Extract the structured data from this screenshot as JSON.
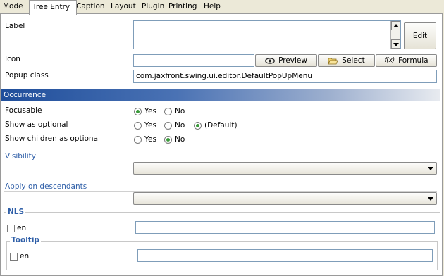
{
  "tabs": [
    "Mode",
    "Tree Entry",
    "Caption",
    "Layout",
    "PlugIn",
    "Printing",
    "Help"
  ],
  "active_tab": "Tree Entry",
  "form": {
    "label_label": "Label",
    "label_value": "",
    "edit_button": "Edit",
    "icon_label": "Icon",
    "icon_value": "",
    "preview_button": "Preview",
    "select_button": "Select",
    "formula_prefix": "f(x)",
    "formula_button": "Formula",
    "popup_label": "Popup class",
    "popup_value": "com.jaxfront.swing.ui.editor.DefaultPopUpMenu"
  },
  "occurrence": {
    "header": "Occurrence",
    "focusable": {
      "label": "Focusable",
      "yes": "Yes",
      "no": "No",
      "selected": "Yes"
    },
    "show_optional": {
      "label": "Show as optional",
      "yes": "Yes",
      "no": "No",
      "default": "(Default)",
      "selected": "(Default)"
    },
    "show_children": {
      "label": "Show children as optional",
      "yes": "Yes",
      "no": "No",
      "selected": "No"
    }
  },
  "visibility": {
    "label": "Visibility",
    "value": ""
  },
  "descendants": {
    "label": "Apply on descendants",
    "value": ""
  },
  "nls": {
    "title": "NLS",
    "lang": "en",
    "value": "",
    "tooltip": {
      "title": "Tooltip",
      "lang": "en",
      "value": ""
    }
  },
  "colors": {
    "section_header": "#1f4e9b",
    "link": "#2f5fa8",
    "radio_selected": "#3a9a3a"
  }
}
